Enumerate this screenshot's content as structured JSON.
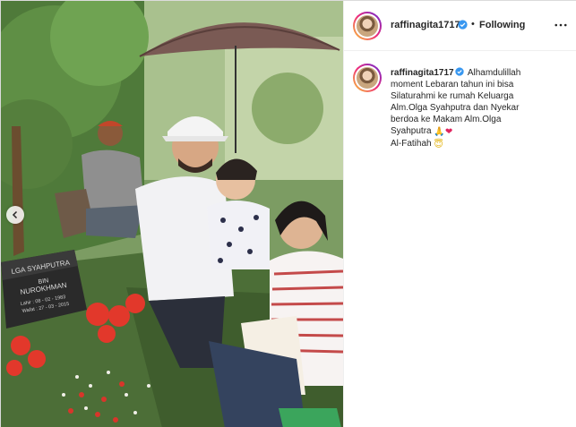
{
  "post": {
    "photo_alt": "Family photo at cemetery",
    "carousel_prev_icon": "chevron-left-icon"
  },
  "header": {
    "username": "raffinagita1717",
    "verified_icon": "verified-badge-icon",
    "separator": "•",
    "follow_status": "Following",
    "more_icon": "more-horizontal-icon"
  },
  "caption": {
    "username": "raffinagita1717",
    "lines": [
      "Alhamdulillah",
      "moment Lebaran tahun ini bisa",
      "Silaturahmi ke rumah Keluarga",
      "Alm.Olga Syahputra dan Nyekar",
      "berdoa ke Makam Alm.Olga",
      "Syahputra",
      "Al-Fatihah"
    ],
    "emoji_pray": "🙏",
    "emoji_heart": "❤",
    "emoji_smile": "😇"
  },
  "grave": {
    "name_line1": "LGA SYAHPUTRA",
    "name_line2": "BIN",
    "name_line3": "NUROKHMAN",
    "born": "Lahir : 08 - 02 - 1983",
    "died": "Wafat : 27 - 03 - 2015"
  },
  "colors": {
    "accent_verified": "#3897f0",
    "text": "#262626",
    "border": "#dbdbdb"
  }
}
